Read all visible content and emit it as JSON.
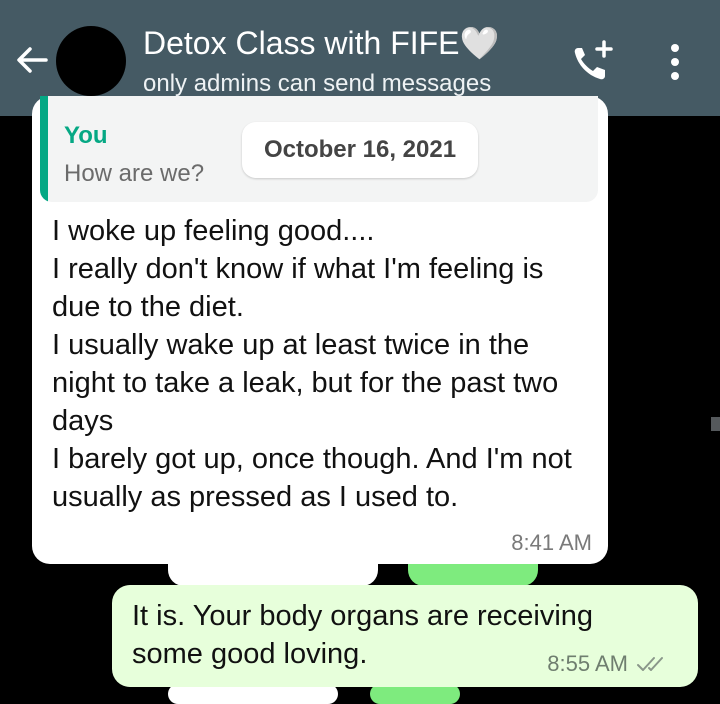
{
  "header": {
    "title": "Detox Class with FIFE🤍",
    "subtitle": "only admins can send messages",
    "back_icon": "arrow-left-icon",
    "call_icon": "add-call-icon",
    "menu_icon": "more-vert-icon"
  },
  "chat": {
    "date_divider": "October 16, 2021",
    "incoming": {
      "quote_author": "You",
      "quote_text": "How are we?",
      "text": "I woke up feeling good....\nI really don't know if what I'm feeling is due to the diet.\nI usually wake up at least twice in the night to take a leak, but for the past two days\nI barely got up, once though. And I'm not usually as pressed as I used to.",
      "time": "8:41 AM"
    },
    "outgoing": {
      "text": "It is. Your body organs are receiving some good loving.",
      "time": "8:55 AM",
      "status_icon": "double-check-icon"
    }
  },
  "colors": {
    "header_bg": "#455A64",
    "quote_accent": "#05A884",
    "outgoing_bg": "#E7FFDB",
    "incoming_bg": "#FFFFFF",
    "chat_bg": "#000000"
  }
}
